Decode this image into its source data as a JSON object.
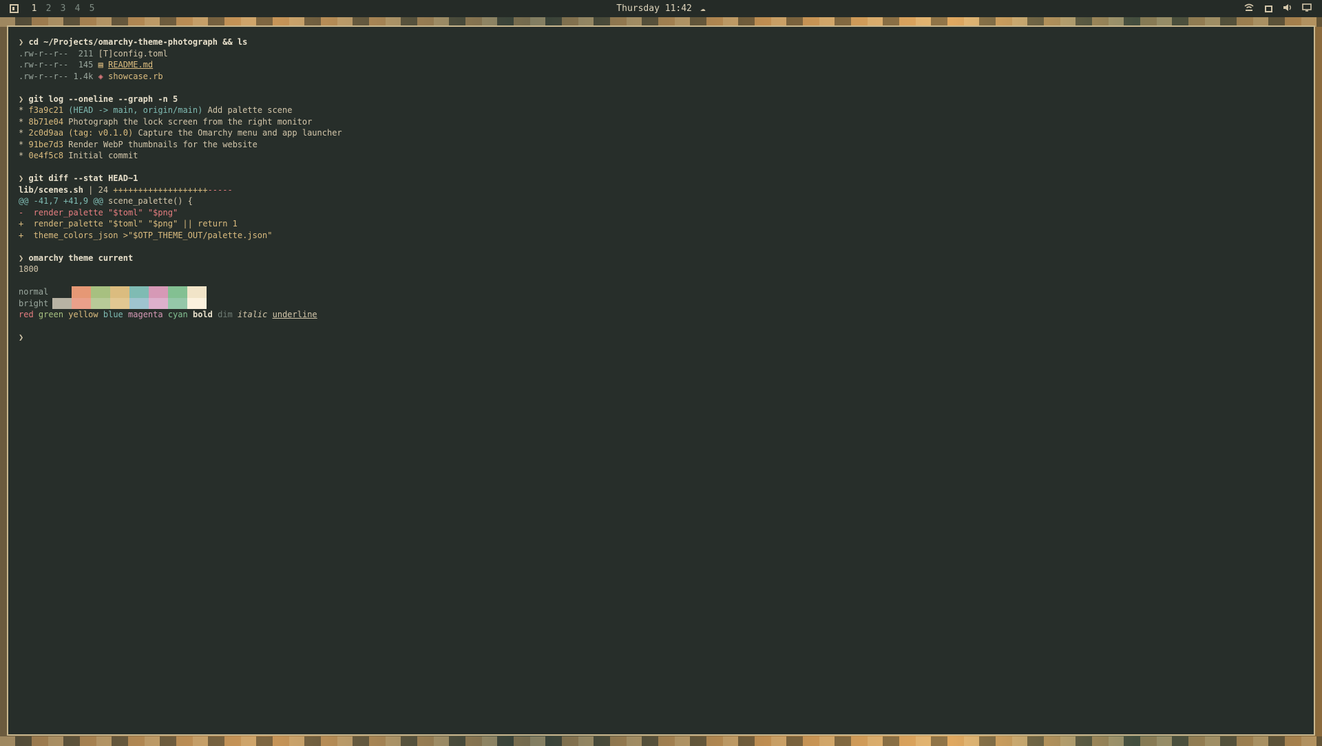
{
  "topbar": {
    "workspaces": [
      "1",
      "2",
      "3",
      "4",
      "5"
    ],
    "active_workspace": "1",
    "clock": "Thursday 11:42",
    "weather_icon": "☁"
  },
  "terminal": {
    "prompt": "❯",
    "cmd1": "cd ~/Projects/omarchy-theme-photograph && ls",
    "ls": [
      {
        "perm": ".rw-r--r--",
        "size": "211",
        "icon": "[T]",
        "name": "config.toml"
      },
      {
        "perm": ".rw-r--r--",
        "size": "145",
        "icon": "▤",
        "name": "README.md"
      },
      {
        "perm": ".rw-r--r--",
        "size": "1.4k",
        "icon": "◈",
        "name": "showcase.rb"
      }
    ],
    "cmd2": "git log --oneline --graph -n 5",
    "log": [
      {
        "star": "*",
        "hash": "f3a9c21",
        "ref": "(HEAD -> main, origin/main)",
        "msg": "Add palette scene"
      },
      {
        "star": "*",
        "hash": "8b71e04",
        "ref": "",
        "msg": "Photograph the lock screen from the right monitor"
      },
      {
        "star": "*",
        "hash": "2c0d9aa",
        "ref": "(tag: v0.1.0)",
        "msg": "Capture the Omarchy menu and app launcher"
      },
      {
        "star": "*",
        "hash": "91be7d3",
        "ref": "",
        "msg": "Render WebP thumbnails for the website"
      },
      {
        "star": "*",
        "hash": "0e4f5c8",
        "ref": "",
        "msg": "Initial commit"
      }
    ],
    "cmd3": "git diff --stat HEAD~1",
    "diff_stat_file": "lib/scenes.sh",
    "diff_stat_sep": " | 24 ",
    "diff_stat_plus": "+++++++++++++++++++",
    "diff_stat_minus": "-----",
    "hunk_header": "@@ -41,7 +41,9 @@",
    "hunk_func": " scene_palette() {",
    "diff_lines": [
      {
        "sign": "-",
        "text": "  render_palette \"$toml\" \"$png\""
      },
      {
        "sign": "+",
        "text": "  render_palette \"$toml\" \"$png\" || return 1"
      },
      {
        "sign": "+",
        "text": "  theme_colors_json >\"$OTP_THEME_OUT/palette.json\""
      }
    ],
    "cmd4": "omarchy theme current",
    "theme_name": "1800",
    "palette_normal_label": "normal",
    "palette_bright_label": "bright",
    "palette_normal": [
      "#272e2a",
      "#e69875",
      "#a7c080",
      "#dbbc7f",
      "#7fbbb3",
      "#d699b6",
      "#83c092",
      "#f1e4c8"
    ],
    "palette_bright": [
      "#b8b3a4",
      "#eaa08a",
      "#b8ca98",
      "#e2c792",
      "#9fc4cf",
      "#ddb0cc",
      "#95c7a9",
      "#fbf1de"
    ],
    "words": {
      "red": "red",
      "green": "green",
      "yellow": "yellow",
      "blue": "blue",
      "magenta": "magenta",
      "cyan": "cyan",
      "bold": "bold",
      "dim": "dim",
      "italic": "italic",
      "underline": "underline"
    }
  }
}
